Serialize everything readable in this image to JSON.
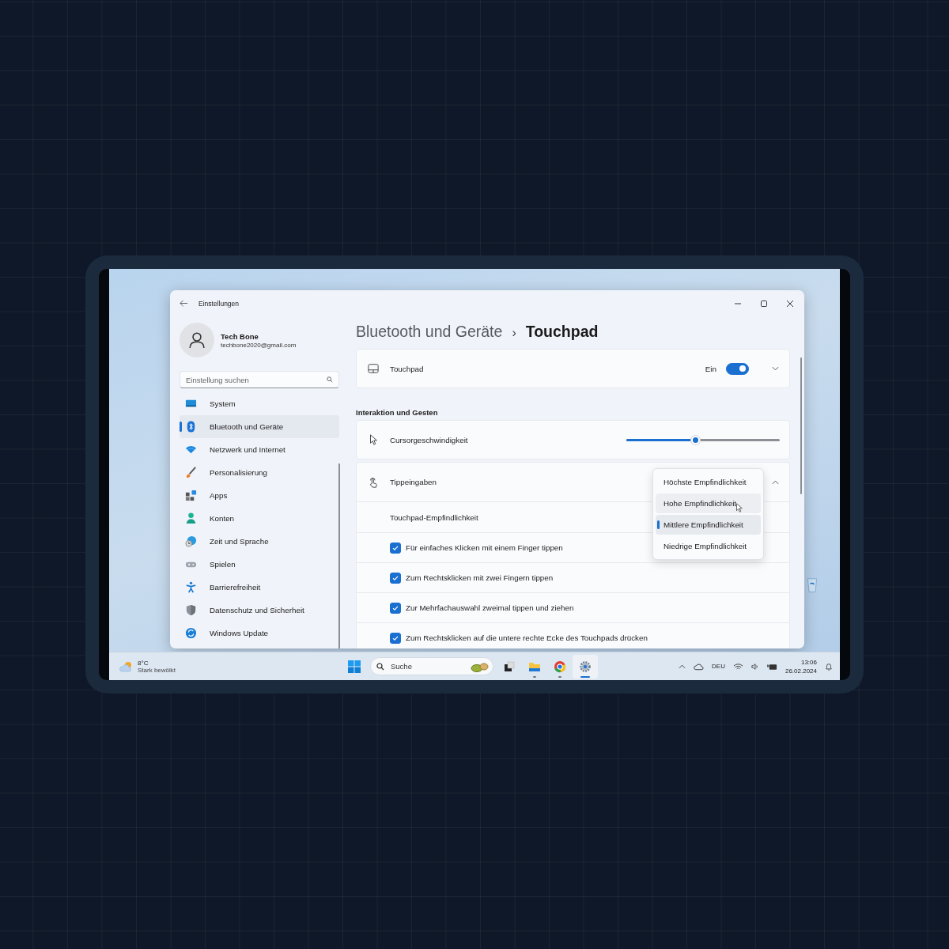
{
  "window": {
    "title": "Einstellungen"
  },
  "user": {
    "name": "Tech Bone",
    "email": "techbone2020@gmail.com"
  },
  "search": {
    "placeholder": "Einstellung suchen"
  },
  "sidebar": {
    "items": [
      {
        "label": "System",
        "selected": false
      },
      {
        "label": "Bluetooth und Geräte",
        "selected": true
      },
      {
        "label": "Netzwerk und Internet",
        "selected": false
      },
      {
        "label": "Personalisierung",
        "selected": false
      },
      {
        "label": "Apps",
        "selected": false
      },
      {
        "label": "Konten",
        "selected": false
      },
      {
        "label": "Zeit und Sprache",
        "selected": false
      },
      {
        "label": "Spielen",
        "selected": false
      },
      {
        "label": "Barrierefreiheit",
        "selected": false
      },
      {
        "label": "Datenschutz und Sicherheit",
        "selected": false
      },
      {
        "label": "Windows Update",
        "selected": false
      }
    ]
  },
  "breadcrumb": {
    "parent": "Bluetooth und Geräte",
    "separator": "›",
    "current": "Touchpad"
  },
  "touchpad": {
    "label": "Touchpad",
    "state_text": "Ein",
    "on": true,
    "expanded": false
  },
  "section_title": "Interaktion und Gesten",
  "cursor_speed": {
    "label": "Cursorgeschwindigkeit",
    "level": 0.45
  },
  "taps": {
    "label": "Tippeingaben",
    "expanded": true,
    "sensitivity_label": "Touchpad-Empfindlichkeit",
    "options": [
      {
        "label": "Für einfaches Klicken mit einem Finger tippen",
        "checked": true
      },
      {
        "label": "Zum Rechtsklicken mit zwei Fingern tippen",
        "checked": true
      },
      {
        "label": "Zur Mehrfachauswahl zweimal tippen und ziehen",
        "checked": true
      },
      {
        "label": "Zum Rechtsklicken auf die untere rechte Ecke des Touchpads drücken",
        "checked": true
      }
    ]
  },
  "sensitivity_menu": {
    "items": [
      {
        "label": "Höchste Empfindlichkeit",
        "selected": false,
        "hovered": false
      },
      {
        "label": "Hohe Empfindlichkeit",
        "selected": false,
        "hovered": true
      },
      {
        "label": "Mittlere Empfindlichkeit",
        "selected": true,
        "hovered": false
      },
      {
        "label": "Niedrige Empfindlichkeit",
        "selected": false,
        "hovered": false
      }
    ]
  },
  "taskbar": {
    "weather": {
      "temperature": "8°C",
      "condition": "Stark bewölkt"
    },
    "search_placeholder": "Suche",
    "apps": [
      {
        "running": false,
        "active": false
      },
      {
        "running": true,
        "active": false
      },
      {
        "running": true,
        "active": false
      },
      {
        "running": true,
        "active": true
      }
    ],
    "language": "DEU",
    "time": "13:06",
    "date": "26.02.2024"
  }
}
